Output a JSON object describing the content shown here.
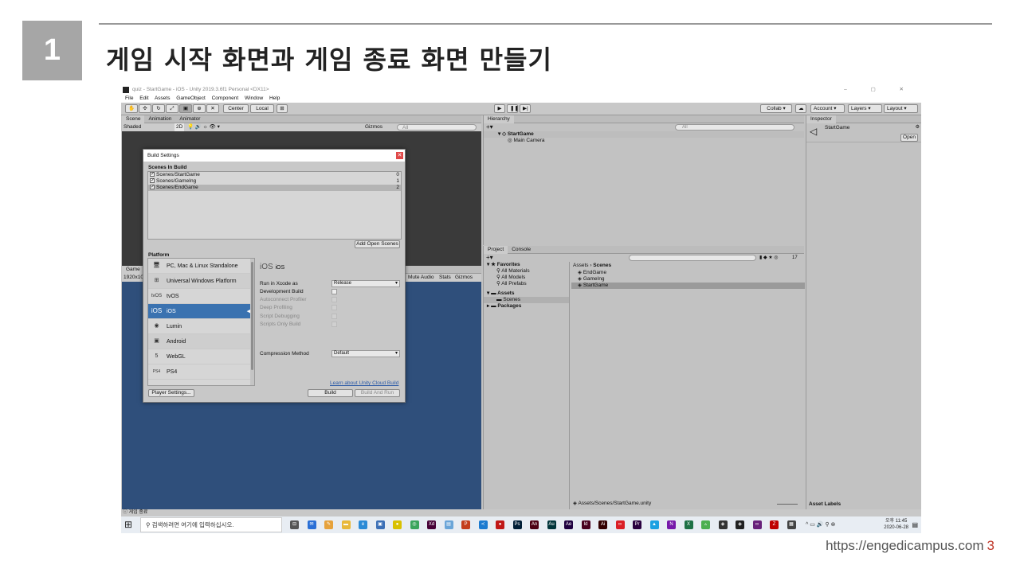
{
  "slide": {
    "number": "1",
    "title": "게임 시작 화면과 게임 종료 화면 만들기",
    "footer_url": "https://engedicampus.com",
    "page_number": "3"
  },
  "window": {
    "title": "quiz - StartGame - iOS - Unity 2019.3.6f1 Personal <DX11>",
    "controls": "– ▢ ✕"
  },
  "menu": [
    "File",
    "Edit",
    "Assets",
    "GameObject",
    "Component",
    "Window",
    "Help"
  ],
  "toolbar": {
    "center": "Center",
    "local": "Local",
    "collab": "Collab ▾",
    "account": "Account",
    "layers": "Layers",
    "layout": "Layout"
  },
  "scene_panel": {
    "tabs": [
      "Scene",
      "Animation",
      "Animator"
    ],
    "shading": "Shaded",
    "mode_2d": "2D",
    "gizmos": "Gizmos",
    "search_placeholder": "All"
  },
  "game_panel": {
    "tab": "Game",
    "resolution": "1920x10",
    "mute": "Mute Audio",
    "stats": "Stats",
    "gizmos": "Gizmos"
  },
  "hierarchy": {
    "tab": "Hierarchy",
    "search_placeholder": "All",
    "scene": "StartGame",
    "items": [
      "Main Camera"
    ]
  },
  "project": {
    "tabs": [
      "Project",
      "Console"
    ],
    "favorites_label": "Favorites",
    "favorites": [
      "All Materials",
      "All Models",
      "All Prefabs"
    ],
    "assets_label": "Assets",
    "asset_folders": [
      "Scenes"
    ],
    "packages_label": "Packages",
    "breadcrumb": [
      "Assets",
      "Scenes"
    ],
    "files": [
      "EndGame",
      "GameIng",
      "StartGame"
    ],
    "selected_file": "StartGame",
    "path": "Assets/Scenes/StartGame.unity",
    "count": "17"
  },
  "inspector": {
    "tab": "Inspector",
    "object_name": "StartGame",
    "open_button": "Open",
    "asset_labels": "Asset Labels"
  },
  "status_bar": "게임 종료",
  "build_settings": {
    "title": "Build Settings",
    "scenes_header": "Scenes In Build",
    "scenes": [
      {
        "name": "Scenes/StartGame",
        "index": "0"
      },
      {
        "name": "Scenes/GameIng",
        "index": "1"
      },
      {
        "name": "Scenes/EndGame",
        "index": "2"
      }
    ],
    "add_open_scenes": "Add Open Scenes",
    "platform_header": "Platform",
    "platforms": [
      {
        "name": "PC, Mac & Linux Standalone",
        "icon": "monitor-icon",
        "glyph": "🖥"
      },
      {
        "name": "Universal Windows Platform",
        "icon": "windows-icon",
        "glyph": "⊞"
      },
      {
        "name": "tvOS",
        "icon": "tvos-icon",
        "glyph": "tvOS"
      },
      {
        "name": "iOS",
        "icon": "ios-icon",
        "glyph": "iOS"
      },
      {
        "name": "Lumin",
        "icon": "lumin-icon",
        "glyph": "◉"
      },
      {
        "name": "Android",
        "icon": "android-icon",
        "glyph": "▣"
      },
      {
        "name": "WebGL",
        "icon": "html5-icon",
        "glyph": "5"
      },
      {
        "name": "PS4",
        "icon": "ps4-icon",
        "glyph": "PS4"
      }
    ],
    "selected_platform": "iOS",
    "detail_title": "iOS",
    "detail_glyph": "iOS",
    "options": {
      "run_in_xcode_label": "Run in Xcode as",
      "run_in_xcode_value": "Release",
      "development_build": "Development Build",
      "autoconnect_profiler": "Autoconnect Profiler",
      "deep_profiling": "Deep Profiling",
      "script_debugging": "Script Debugging",
      "scripts_only_build": "Scripts Only Build",
      "compression_label": "Compression Method",
      "compression_value": "Default"
    },
    "cloud_link": "Learn about Unity Cloud Build",
    "player_settings": "Player Settings...",
    "build": "Build",
    "build_and_run": "Build And Run"
  },
  "taskbar": {
    "search_placeholder": "검색하려면 여기에 입력하십시오.",
    "time": "오후 11:45",
    "date": "2020-06-28",
    "apps": [
      {
        "icon": "task-view-icon",
        "color": "#555",
        "glyph": "⊟"
      },
      {
        "icon": "mail-icon",
        "color": "#2a6fd6",
        "glyph": "✉"
      },
      {
        "icon": "paint-icon",
        "color": "#e6a23c",
        "glyph": "✎"
      },
      {
        "icon": "explorer-icon",
        "color": "#e8b838",
        "glyph": "▬"
      },
      {
        "icon": "ie-icon",
        "color": "#2a8ad6",
        "glyph": "e"
      },
      {
        "icon": "photos-icon",
        "color": "#3b6fb6",
        "glyph": "▣"
      },
      {
        "icon": "kakaotalk-icon",
        "color": "#d9c100",
        "glyph": "●"
      },
      {
        "icon": "chrome-icon",
        "color": "#3ba55c",
        "glyph": "◎"
      },
      {
        "icon": "xd-icon",
        "color": "#470137",
        "glyph": "Xd"
      },
      {
        "icon": "notepad-icon",
        "color": "#6aa5d8",
        "glyph": "▤"
      },
      {
        "icon": "powerpoint-icon",
        "color": "#c43e1c",
        "glyph": "P"
      },
      {
        "icon": "vscode-icon",
        "color": "#1c7bd0",
        "glyph": "≺"
      },
      {
        "icon": "record-icon",
        "color": "#c01818",
        "glyph": "●"
      },
      {
        "icon": "photoshop-icon",
        "color": "#001e36",
        "glyph": "Ps"
      },
      {
        "icon": "animate-icon",
        "color": "#4d0012",
        "glyph": "An"
      },
      {
        "icon": "audition-icon",
        "color": "#00343a",
        "glyph": "Au"
      },
      {
        "icon": "aftereffects-icon",
        "color": "#1f0040",
        "glyph": "Ae"
      },
      {
        "icon": "indesign-icon",
        "color": "#49021f",
        "glyph": "Id"
      },
      {
        "icon": "illustrator-icon",
        "color": "#330000",
        "glyph": "Ai"
      },
      {
        "icon": "cc-icon",
        "color": "#da1f26",
        "glyph": "∞"
      },
      {
        "icon": "premiere-icon",
        "color": "#2a003f",
        "glyph": "Pr"
      },
      {
        "icon": "app-icon",
        "color": "#1ba1e2",
        "glyph": "▲"
      },
      {
        "icon": "onenote-icon",
        "color": "#7719aa",
        "glyph": "N"
      },
      {
        "icon": "excel-icon",
        "color": "#1e7145",
        "glyph": "X"
      },
      {
        "icon": "app2-icon",
        "color": "#4caf50",
        "glyph": "▵"
      },
      {
        "icon": "unity-hub-icon",
        "color": "#333",
        "glyph": "◈"
      },
      {
        "icon": "unity-icon",
        "color": "#222",
        "glyph": "◈"
      },
      {
        "icon": "visual-studio-icon",
        "color": "#68217a",
        "glyph": "∞"
      },
      {
        "icon": "filezilla-icon",
        "color": "#bf0000",
        "glyph": "Z"
      },
      {
        "icon": "calculator-icon",
        "color": "#444",
        "glyph": "▦"
      }
    ]
  }
}
